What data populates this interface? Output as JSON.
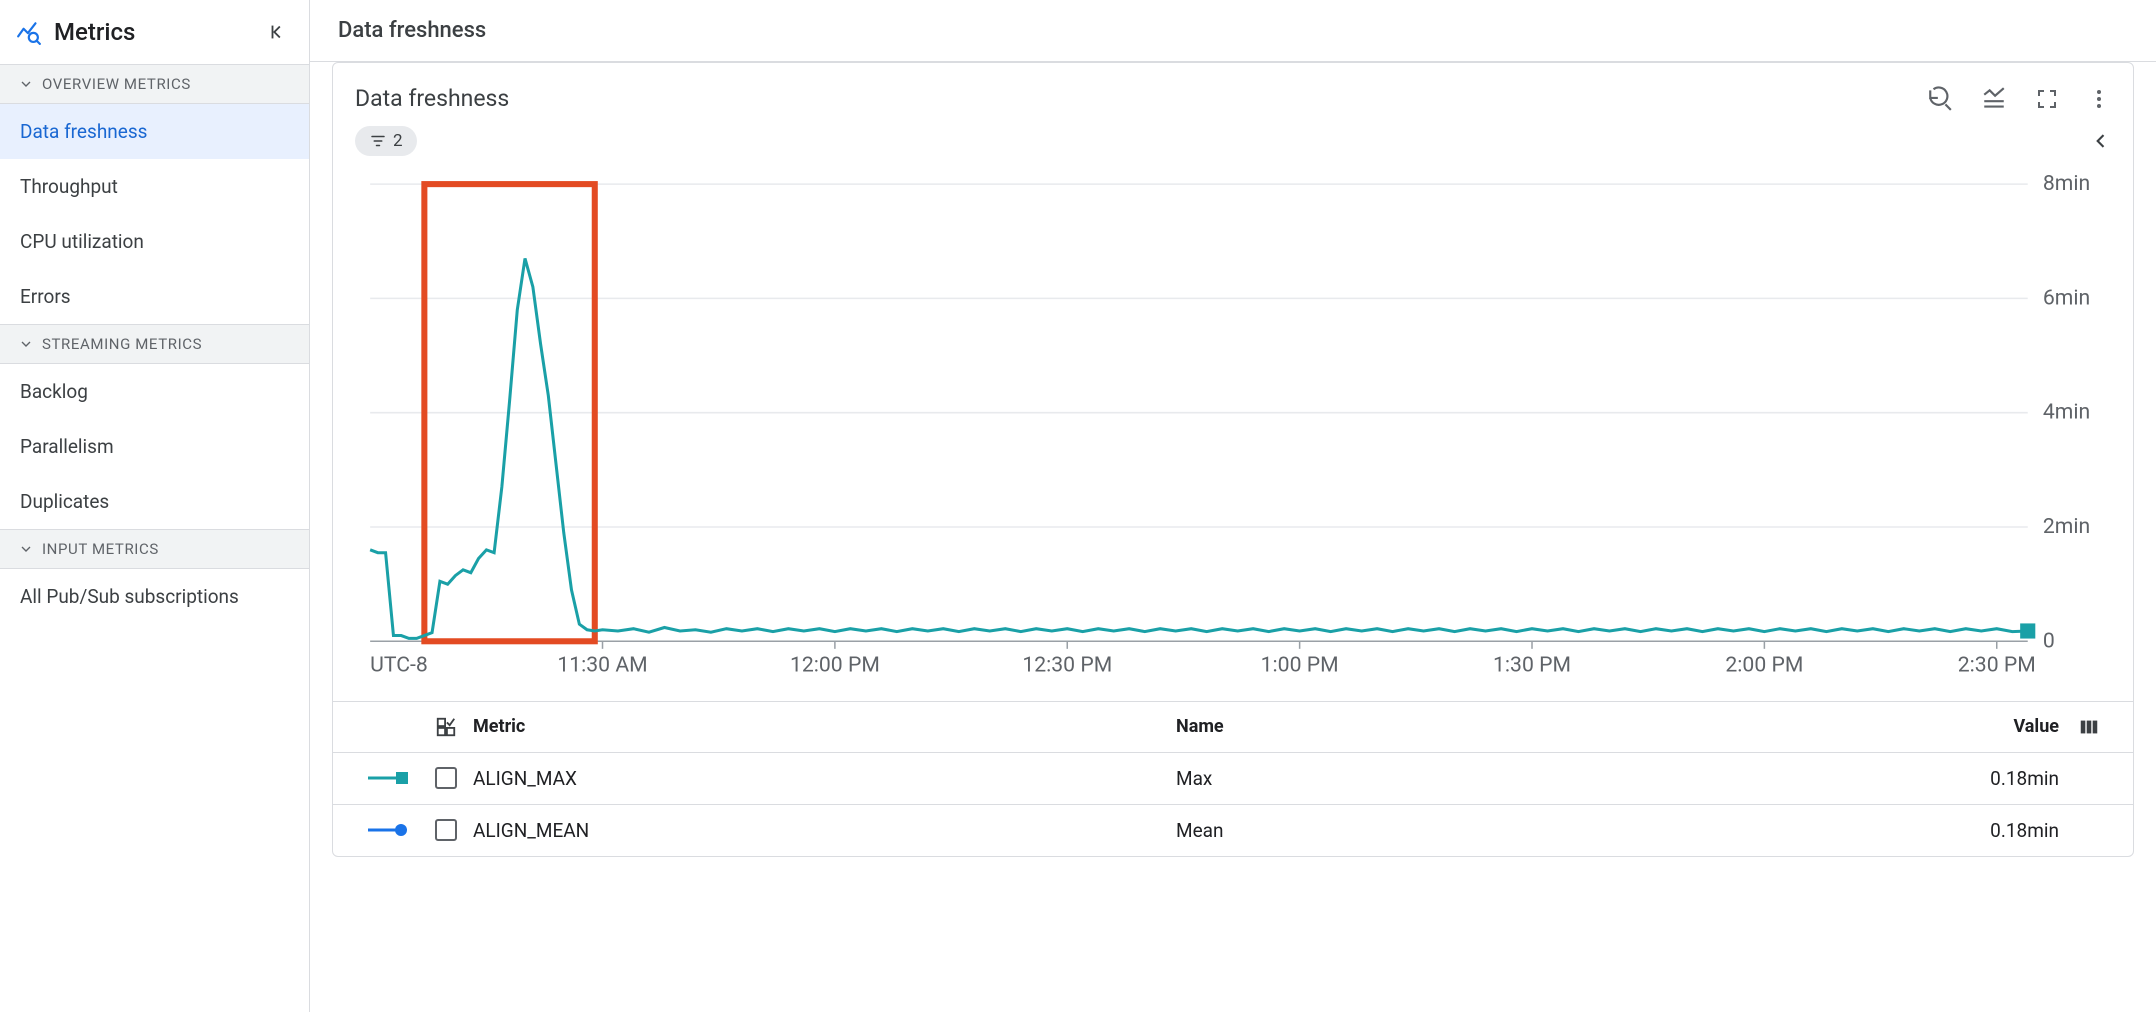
{
  "sidebar": {
    "title": "Metrics",
    "sections": [
      {
        "label": "OVERVIEW METRICS",
        "items": [
          "Data freshness",
          "Throughput",
          "CPU utilization",
          "Errors"
        ]
      },
      {
        "label": "STREAMING METRICS",
        "items": [
          "Backlog",
          "Parallelism",
          "Duplicates"
        ]
      },
      {
        "label": "INPUT METRICS",
        "items": [
          "All Pub/Sub subscriptions"
        ]
      }
    ],
    "selected": "Data freshness"
  },
  "page": {
    "title": "Data freshness"
  },
  "card": {
    "title": "Data freshness",
    "filter_chip_count": "2",
    "timezone_label": "UTC-8"
  },
  "legend": {
    "head": {
      "metric": "Metric",
      "name": "Name",
      "value": "Value"
    },
    "rows": [
      {
        "series_color": "#1aa0a7",
        "marker": "square",
        "metric": "ALIGN_MAX",
        "name": "Max",
        "value": "0.18min"
      },
      {
        "series_color": "#1a73e8",
        "marker": "circle",
        "metric": "ALIGN_MEAN",
        "name": "Mean",
        "value": "0.18min"
      }
    ]
  },
  "chart_data": {
    "type": "line",
    "xlabel": "",
    "ylabel": "",
    "timezone": "UTC-8",
    "ylim": [
      0,
      8
    ],
    "y_unit": "min",
    "y_ticks": [
      0,
      2,
      4,
      6,
      8
    ],
    "y_tick_labels": [
      "0",
      "2min",
      "4min",
      "6min",
      "8min"
    ],
    "x_tick_labels": [
      "11:30 AM",
      "12:00 PM",
      "12:30 PM",
      "1:00 PM",
      "1:30 PM",
      "2:00 PM",
      "2:30 PM"
    ],
    "x_tick_minutes": [
      30,
      60,
      90,
      120,
      150,
      180,
      210
    ],
    "x_range_minutes": [
      0,
      214
    ],
    "highlight_box_minutes": [
      7,
      29
    ],
    "series": [
      {
        "name": "Max",
        "metric": "ALIGN_MAX",
        "color": "#1aa0a7",
        "current_value_minutes": 0.18,
        "points_minutes_xy": [
          [
            0,
            1.6
          ],
          [
            1,
            1.55
          ],
          [
            2,
            1.55
          ],
          [
            3,
            0.1
          ],
          [
            4,
            0.1
          ],
          [
            5,
            0.05
          ],
          [
            6,
            0.05
          ],
          [
            7,
            0.1
          ],
          [
            8,
            0.15
          ],
          [
            9,
            1.05
          ],
          [
            10,
            1.0
          ],
          [
            11,
            1.15
          ],
          [
            12,
            1.25
          ],
          [
            13,
            1.2
          ],
          [
            14,
            1.45
          ],
          [
            15,
            1.6
          ],
          [
            16,
            1.55
          ],
          [
            17,
            2.7
          ],
          [
            18,
            4.2
          ],
          [
            19,
            5.8
          ],
          [
            20,
            6.7
          ],
          [
            21,
            6.2
          ],
          [
            22,
            5.2
          ],
          [
            23,
            4.3
          ],
          [
            24,
            3.1
          ],
          [
            25,
            1.9
          ],
          [
            26,
            0.9
          ],
          [
            27,
            0.3
          ],
          [
            28,
            0.2
          ],
          [
            29,
            0.18
          ],
          [
            30,
            0.2
          ],
          [
            32,
            0.18
          ],
          [
            34,
            0.22
          ],
          [
            36,
            0.16
          ],
          [
            38,
            0.24
          ],
          [
            40,
            0.18
          ],
          [
            42,
            0.2
          ],
          [
            44,
            0.16
          ],
          [
            46,
            0.22
          ],
          [
            48,
            0.18
          ],
          [
            50,
            0.22
          ],
          [
            52,
            0.17
          ],
          [
            54,
            0.22
          ],
          [
            56,
            0.18
          ],
          [
            58,
            0.22
          ],
          [
            60,
            0.17
          ],
          [
            62,
            0.22
          ],
          [
            64,
            0.18
          ],
          [
            66,
            0.22
          ],
          [
            68,
            0.17
          ],
          [
            70,
            0.22
          ],
          [
            72,
            0.18
          ],
          [
            74,
            0.22
          ],
          [
            76,
            0.17
          ],
          [
            78,
            0.22
          ],
          [
            80,
            0.18
          ],
          [
            82,
            0.22
          ],
          [
            84,
            0.17
          ],
          [
            86,
            0.22
          ],
          [
            88,
            0.18
          ],
          [
            90,
            0.22
          ],
          [
            92,
            0.17
          ],
          [
            94,
            0.22
          ],
          [
            96,
            0.18
          ],
          [
            98,
            0.22
          ],
          [
            100,
            0.17
          ],
          [
            102,
            0.22
          ],
          [
            104,
            0.18
          ],
          [
            106,
            0.22
          ],
          [
            108,
            0.17
          ],
          [
            110,
            0.22
          ],
          [
            112,
            0.18
          ],
          [
            114,
            0.22
          ],
          [
            116,
            0.17
          ],
          [
            118,
            0.22
          ],
          [
            120,
            0.18
          ],
          [
            122,
            0.22
          ],
          [
            124,
            0.17
          ],
          [
            126,
            0.22
          ],
          [
            128,
            0.18
          ],
          [
            130,
            0.22
          ],
          [
            132,
            0.17
          ],
          [
            134,
            0.22
          ],
          [
            136,
            0.18
          ],
          [
            138,
            0.22
          ],
          [
            140,
            0.17
          ],
          [
            142,
            0.22
          ],
          [
            144,
            0.18
          ],
          [
            146,
            0.22
          ],
          [
            148,
            0.17
          ],
          [
            150,
            0.22
          ],
          [
            152,
            0.18
          ],
          [
            154,
            0.22
          ],
          [
            156,
            0.17
          ],
          [
            158,
            0.22
          ],
          [
            160,
            0.18
          ],
          [
            162,
            0.22
          ],
          [
            164,
            0.17
          ],
          [
            166,
            0.22
          ],
          [
            168,
            0.18
          ],
          [
            170,
            0.22
          ],
          [
            172,
            0.17
          ],
          [
            174,
            0.22
          ],
          [
            176,
            0.18
          ],
          [
            178,
            0.22
          ],
          [
            180,
            0.17
          ],
          [
            182,
            0.22
          ],
          [
            184,
            0.18
          ],
          [
            186,
            0.22
          ],
          [
            188,
            0.17
          ],
          [
            190,
            0.22
          ],
          [
            192,
            0.18
          ],
          [
            194,
            0.22
          ],
          [
            196,
            0.17
          ],
          [
            198,
            0.22
          ],
          [
            200,
            0.18
          ],
          [
            202,
            0.22
          ],
          [
            204,
            0.17
          ],
          [
            206,
            0.22
          ],
          [
            208,
            0.18
          ],
          [
            210,
            0.22
          ],
          [
            212,
            0.17
          ],
          [
            214,
            0.18
          ]
        ]
      }
    ],
    "end_marker": {
      "series": "Max",
      "shape": "square",
      "color": "#1aa0a7"
    }
  }
}
